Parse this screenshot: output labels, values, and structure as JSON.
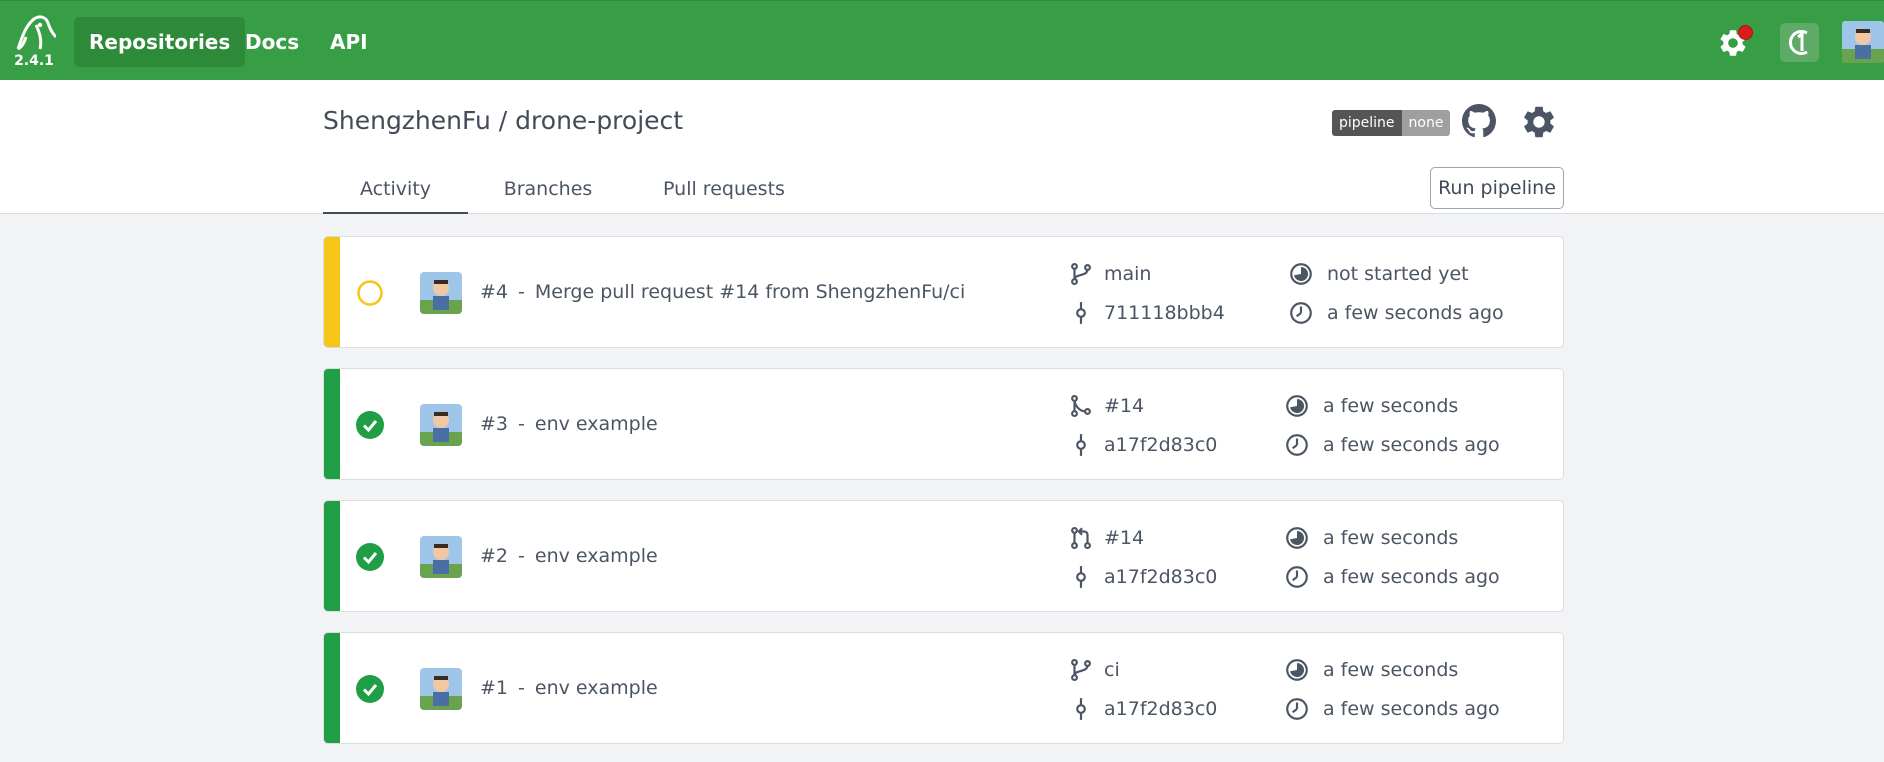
{
  "navbar": {
    "version": "2.4.1",
    "items": [
      {
        "label": "Repositories"
      },
      {
        "label": "Docs"
      },
      {
        "label": "API"
      }
    ]
  },
  "repo": {
    "title": "ShengzhenFu / drone-project",
    "badge_left": "pipeline",
    "badge_right": "none"
  },
  "tabs": [
    {
      "label": "Activity"
    },
    {
      "label": "Branches"
    },
    {
      "label": "Pull requests"
    }
  ],
  "run_button": "Run pipeline",
  "pipelines": [
    {
      "number": "#4",
      "sep": "-",
      "message": "Merge pull request #14 from ShengzhenFu/ci",
      "ref": "main",
      "ref_icon": "branch-icon",
      "commit": "711118bbb4",
      "duration": "not started yet",
      "created": "a few seconds ago",
      "status": "pending",
      "status_color": "#f5c518"
    },
    {
      "number": "#3",
      "sep": "-",
      "message": "env example",
      "ref": "#14",
      "ref_icon": "merge-icon",
      "commit": "a17f2d83c0",
      "duration": "a few seconds",
      "created": "a few seconds ago",
      "status": "success",
      "status_color": "#1f9e45"
    },
    {
      "number": "#2",
      "sep": "-",
      "message": "env example",
      "ref": "#14",
      "ref_icon": "pull-request-icon",
      "commit": "a17f2d83c0",
      "duration": "a few seconds",
      "created": "a few seconds ago",
      "status": "success",
      "status_color": "#1f9e45"
    },
    {
      "number": "#1",
      "sep": "-",
      "message": "env example",
      "ref": "ci",
      "ref_icon": "branch-icon",
      "commit": "a17f2d83c0",
      "duration": "a few seconds",
      "created": "a few seconds ago",
      "status": "success",
      "status_color": "#1f9e45"
    }
  ]
}
